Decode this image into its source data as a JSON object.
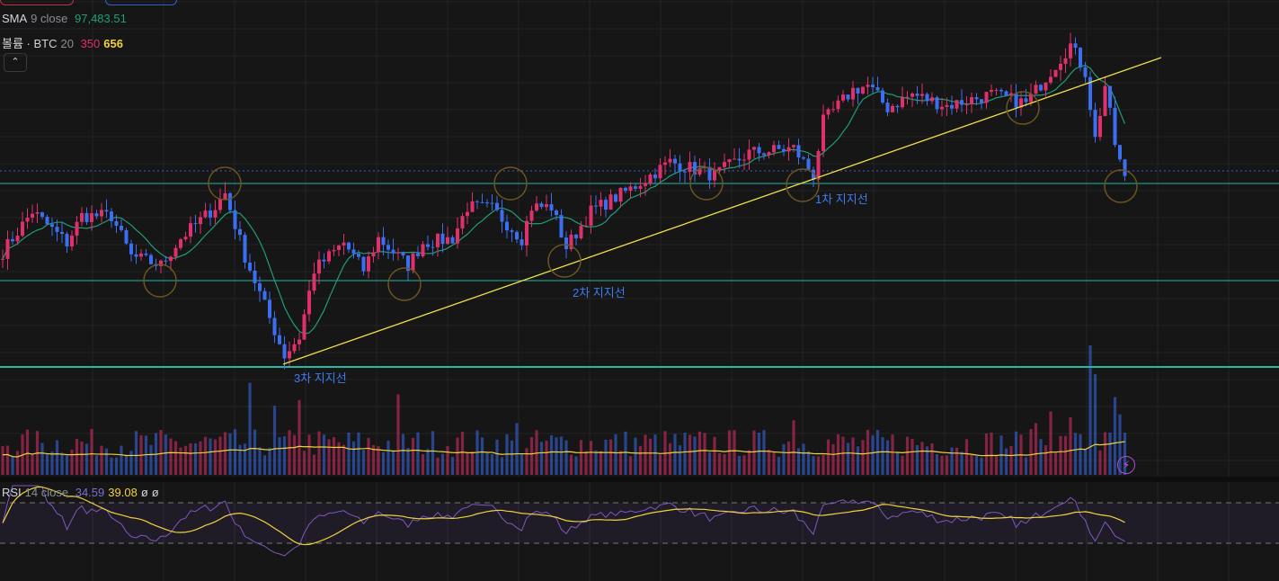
{
  "legend": {
    "sma": {
      "name": "SMA",
      "params": "9 close",
      "value": "97,483.51"
    },
    "volume": {
      "name": "볼륨 · BTC",
      "params": "20",
      "value1": "350",
      "value2": "656"
    },
    "rsi": {
      "name": "RSI",
      "params": "14 close",
      "value": "34.59",
      "ma": "39.08",
      "extra1": "ø",
      "extra2": "ø"
    }
  },
  "annotations": {
    "support1": "1차 지지선",
    "support2": "2차 지지선",
    "support3": "3차 지지선"
  },
  "buttons": {
    "collapse": "⌃",
    "bolt": "⚡"
  },
  "colors": {
    "up": "#e0306a",
    "down": "#3b6ef0",
    "sma": "#1f9e78",
    "support": "#26b7a0",
    "trend": "#f0e04a",
    "circle": "#6b5520",
    "rsi": "#7e57c2",
    "rsi_ma": "#f0d23a",
    "vol_ma": "#f0d23a"
  },
  "chart_data": {
    "type": "candlestick",
    "price_keypoints": [
      [
        0,
        94096
      ],
      [
        6,
        95536
      ],
      [
        13,
        94416
      ],
      [
        16,
        95376
      ],
      [
        22,
        95376
      ],
      [
        26,
        93936
      ],
      [
        32,
        93616
      ],
      [
        36,
        94576
      ],
      [
        43,
        95696
      ],
      [
        45,
        96176
      ],
      [
        49,
        93936
      ],
      [
        53,
        92176
      ],
      [
        57,
        90416
      ],
      [
        60,
        91056
      ],
      [
        63,
        93456
      ],
      [
        69,
        94416
      ],
      [
        73,
        93456
      ],
      [
        76,
        94576
      ],
      [
        82,
        93616
      ],
      [
        85,
        94416
      ],
      [
        91,
        94576
      ],
      [
        94,
        95696
      ],
      [
        99,
        95632
      ],
      [
        105,
        94576
      ],
      [
        107,
        95696
      ],
      [
        111,
        95696
      ],
      [
        114,
        94256
      ],
      [
        119,
        95536
      ],
      [
        127,
        96336
      ],
      [
        135,
        97296
      ],
      [
        144,
        96816
      ],
      [
        151,
        97616
      ],
      [
        160,
        97776
      ],
      [
        164,
        96816
      ],
      [
        166,
        98736
      ],
      [
        172,
        99856
      ],
      [
        175,
        100016
      ],
      [
        179,
        99216
      ],
      [
        184,
        99696
      ],
      [
        191,
        99296
      ],
      [
        200,
        99696
      ],
      [
        207,
        99376
      ],
      [
        216,
        101456
      ],
      [
        219,
        100496
      ],
      [
        221,
        98096
      ],
      [
        223,
        100016
      ],
      [
        225,
        97936
      ],
      [
        227,
        96656
      ]
    ],
    "support_levels": [
      96500,
      93150,
      90000
    ],
    "volume_spikes": [
      [
        50,
        3.2
      ],
      [
        55,
        2.4
      ],
      [
        60,
        2.6
      ],
      [
        80,
        2.8
      ],
      [
        104,
        1.8
      ],
      [
        160,
        1.9
      ],
      [
        209,
        1.8
      ],
      [
        212,
        2.2
      ],
      [
        216,
        2.0
      ],
      [
        220,
        4.5
      ],
      [
        221,
        3.5
      ],
      [
        225,
        2.7
      ],
      [
        226,
        2.1
      ]
    ],
    "rsi_bands": [
      70,
      30
    ]
  }
}
